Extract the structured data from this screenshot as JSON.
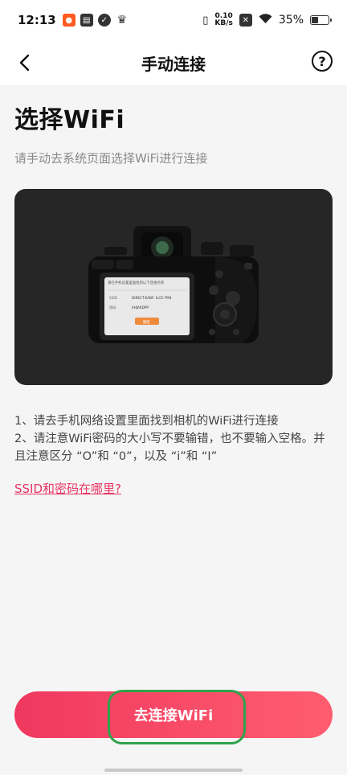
{
  "status_bar": {
    "time": "12:13",
    "speed_value": "0.10",
    "speed_unit": "KB/s",
    "battery": "35%"
  },
  "header": {
    "title": "手动连接",
    "help_label": "?"
  },
  "main": {
    "heading": "选择WiFi",
    "subtitle": "请手动去系统页面选择WiFi进行连接",
    "camera_screen": {
      "line1": "请在手机设置里面找到以下连接名称",
      "ssid_label": "SSID",
      "ssid_value": "DIRECT-EABF: ILCE-7M4",
      "password_label": "密码",
      "password_value": "4HJAKDPP",
      "ok_label": "确定"
    },
    "instructions": [
      "1、请去手机网络设置里面找到相机的WiFi进行连接",
      "2、请注意WiFi密码的大小写不要输错，也不要输入空格。并且注意区分 “O”和 “0”，以及 “i”和 “I”"
    ],
    "help_link": "SSID和密码在哪里?"
  },
  "footer": {
    "connect_label": "去连接WiFi"
  },
  "colors": {
    "accent": "#f0385f",
    "link": "#e83565",
    "highlight": "#2fa34a"
  }
}
